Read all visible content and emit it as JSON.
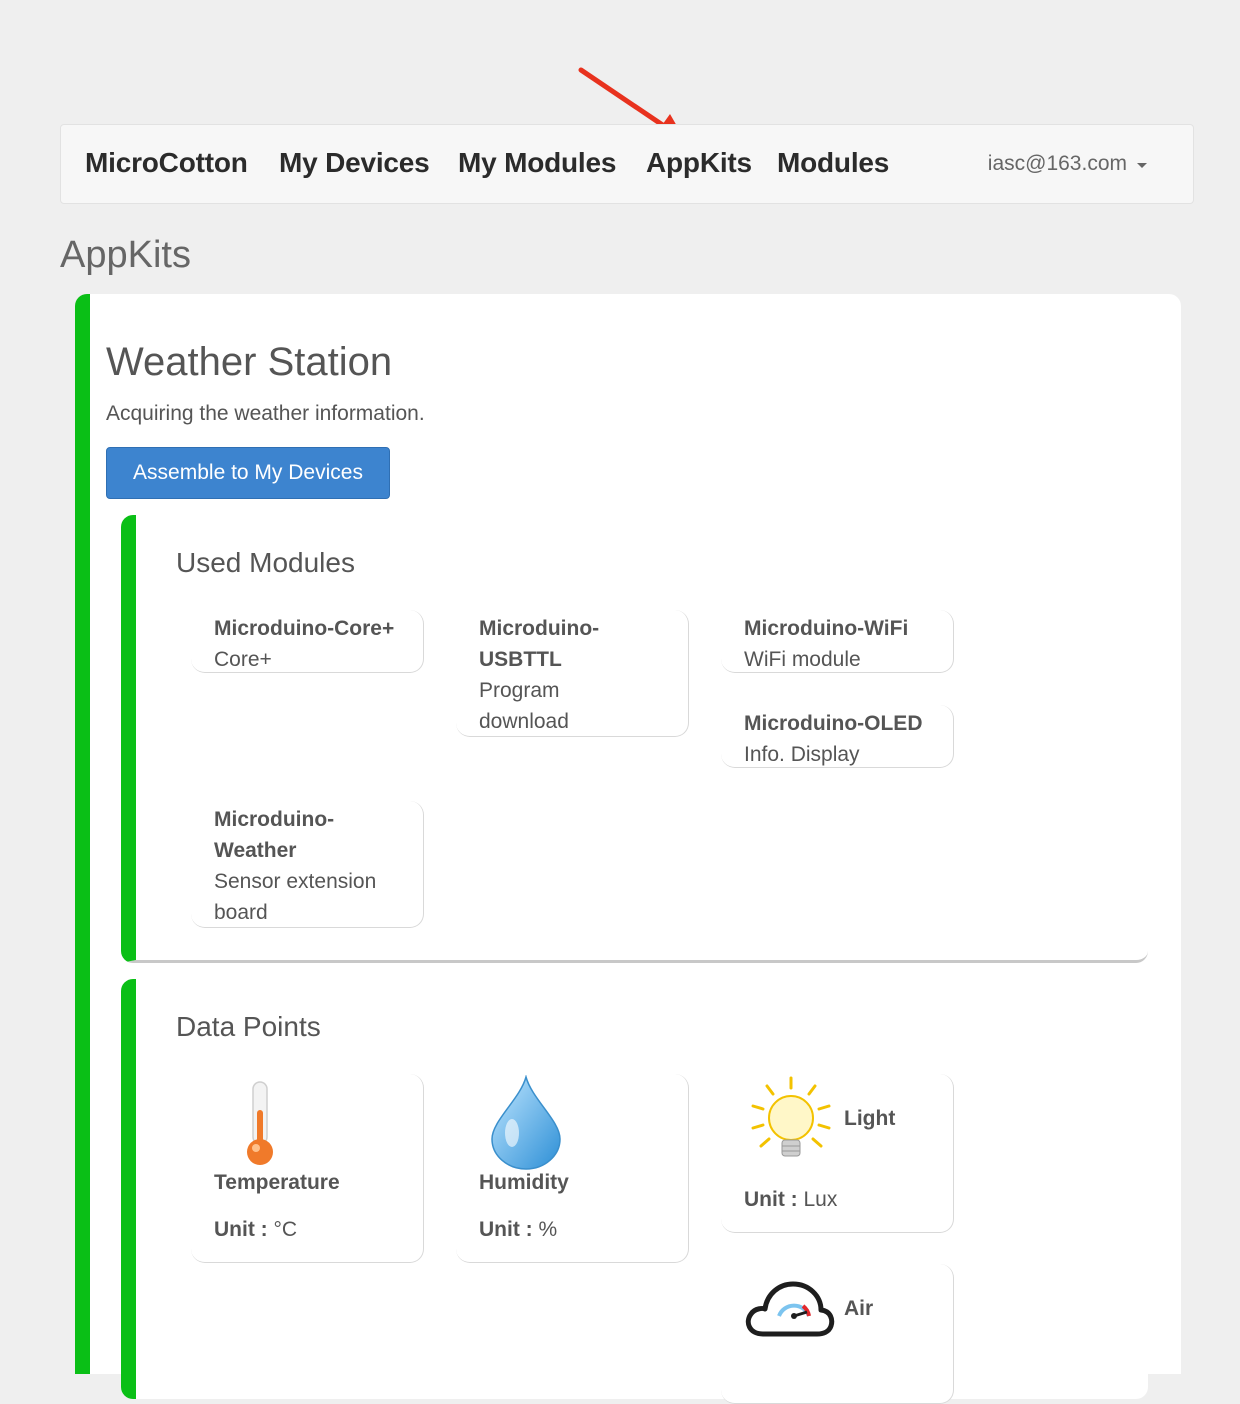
{
  "nav": {
    "brand": "MicroCotton",
    "items": [
      {
        "label": "My Devices"
      },
      {
        "label": "My Modules"
      },
      {
        "label": "AppKits"
      },
      {
        "label": "Modules"
      }
    ],
    "user_email": "iasc@163.com"
  },
  "page_title": "AppKits",
  "kit": {
    "title": "Weather Station",
    "description": "Acquiring the weather information.",
    "assemble_label": "Assemble to My Devices",
    "used_modules": {
      "title": "Used Modules",
      "modules": [
        {
          "name": "Microduino-Core+",
          "desc": "Core+"
        },
        {
          "name": "Microduino-USBTTL",
          "desc": "Program download"
        },
        {
          "name": "Microduino-WiFi",
          "desc": "WiFi module"
        },
        {
          "name": "Microduino-OLED",
          "desc": "Info. Display"
        },
        {
          "name": "Microduino-Weather",
          "desc": "Sensor extension board"
        }
      ]
    },
    "data_points": {
      "title": "Data Points",
      "unit_label": "Unit :",
      "points": [
        {
          "name": "Temperature",
          "unit": "°C",
          "icon": "thermometer-icon"
        },
        {
          "name": "Humidity",
          "unit": "%",
          "icon": "water-drop-icon"
        },
        {
          "name": "Light",
          "unit": "Lux",
          "icon": "light-bulb-icon"
        },
        {
          "name": "Air",
          "unit": "",
          "icon": "air-cloud-icon"
        }
      ]
    }
  },
  "colors": {
    "accent_green": "#0abf16",
    "button_blue": "#3d84cf",
    "annotation_red": "#e8321e"
  }
}
